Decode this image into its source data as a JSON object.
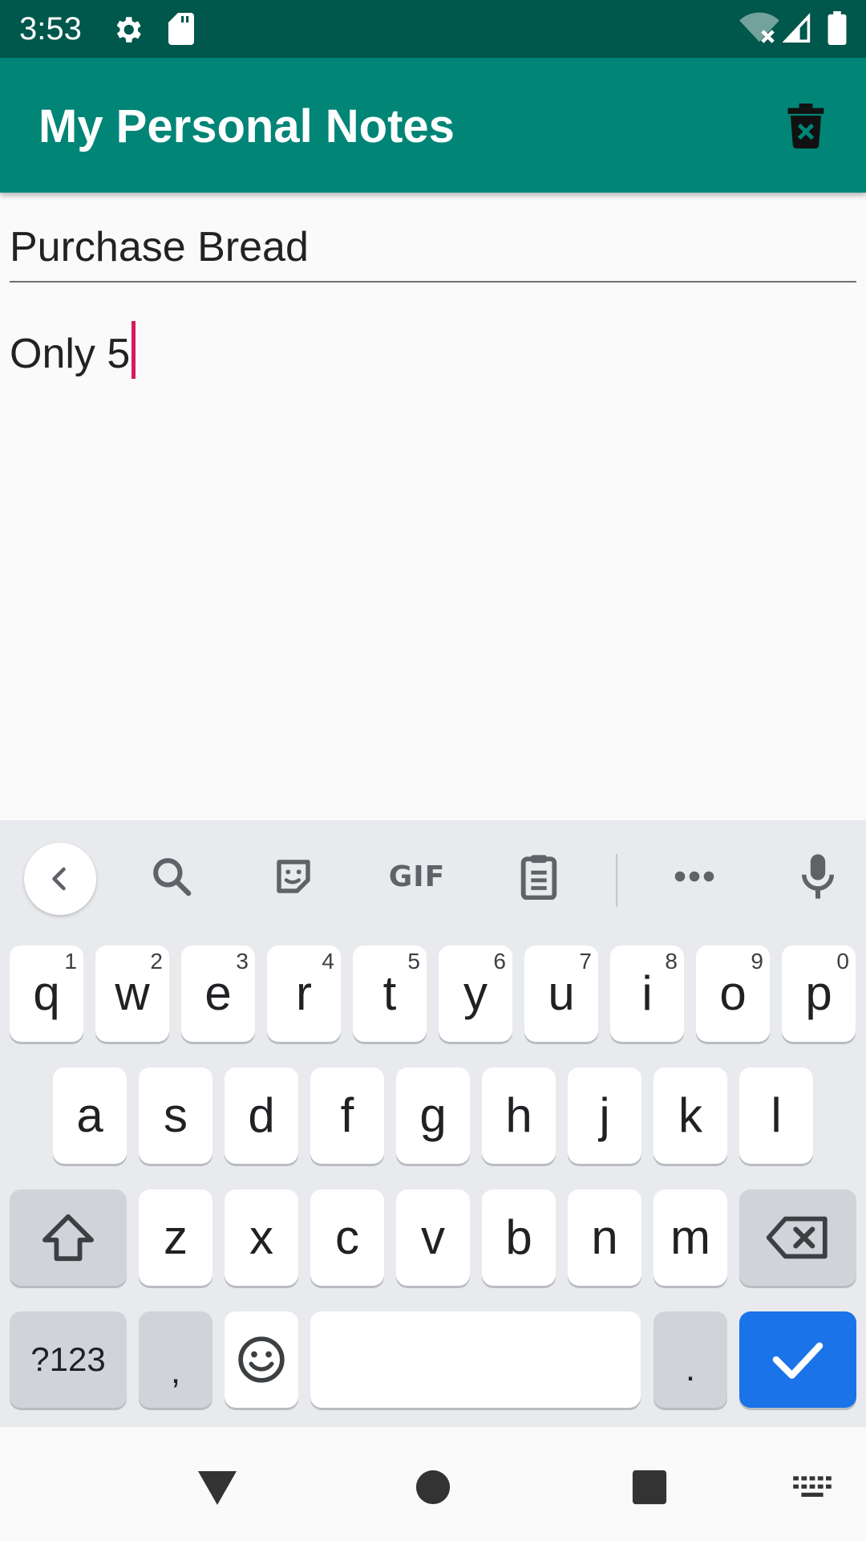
{
  "status_bar": {
    "time": "3:53",
    "icons": [
      "gear-icon",
      "sd-card-icon",
      "wifi-off-icon",
      "signal-icon",
      "battery-icon"
    ]
  },
  "app_bar": {
    "title": "My Personal Notes",
    "delete_icon": "delete-forever-icon"
  },
  "note": {
    "title": "Purchase Bread",
    "body": "Only 5"
  },
  "keyboard": {
    "toolbar": {
      "icons": [
        "back-icon",
        "search-icon",
        "sticker-icon",
        "gif-icon",
        "clipboard-icon",
        "more-icon",
        "mic-icon"
      ],
      "gif_label": "GIF"
    },
    "row1": [
      {
        "char": "q",
        "hint": "1"
      },
      {
        "char": "w",
        "hint": "2"
      },
      {
        "char": "e",
        "hint": "3"
      },
      {
        "char": "r",
        "hint": "4"
      },
      {
        "char": "t",
        "hint": "5"
      },
      {
        "char": "y",
        "hint": "6"
      },
      {
        "char": "u",
        "hint": "7"
      },
      {
        "char": "i",
        "hint": "8"
      },
      {
        "char": "o",
        "hint": "9"
      },
      {
        "char": "p",
        "hint": "0"
      }
    ],
    "row2": [
      "a",
      "s",
      "d",
      "f",
      "g",
      "h",
      "j",
      "k",
      "l"
    ],
    "row3": [
      "z",
      "x",
      "c",
      "v",
      "b",
      "n",
      "m"
    ],
    "row4": {
      "symbols": "?123",
      "comma": ",",
      "period": "."
    },
    "colors": {
      "background": "#e8eaed",
      "key": "#ffffff",
      "modifier_key": "#d0d3d8",
      "action_key": "#1a73e8"
    }
  },
  "colors": {
    "status_bar": "#00574b",
    "app_bar": "#008577",
    "caret": "#d81b60"
  },
  "nav_bar": {
    "icons": [
      "back-triangle-icon",
      "home-circle-icon",
      "recents-square-icon",
      "keyboard-switch-icon"
    ]
  }
}
